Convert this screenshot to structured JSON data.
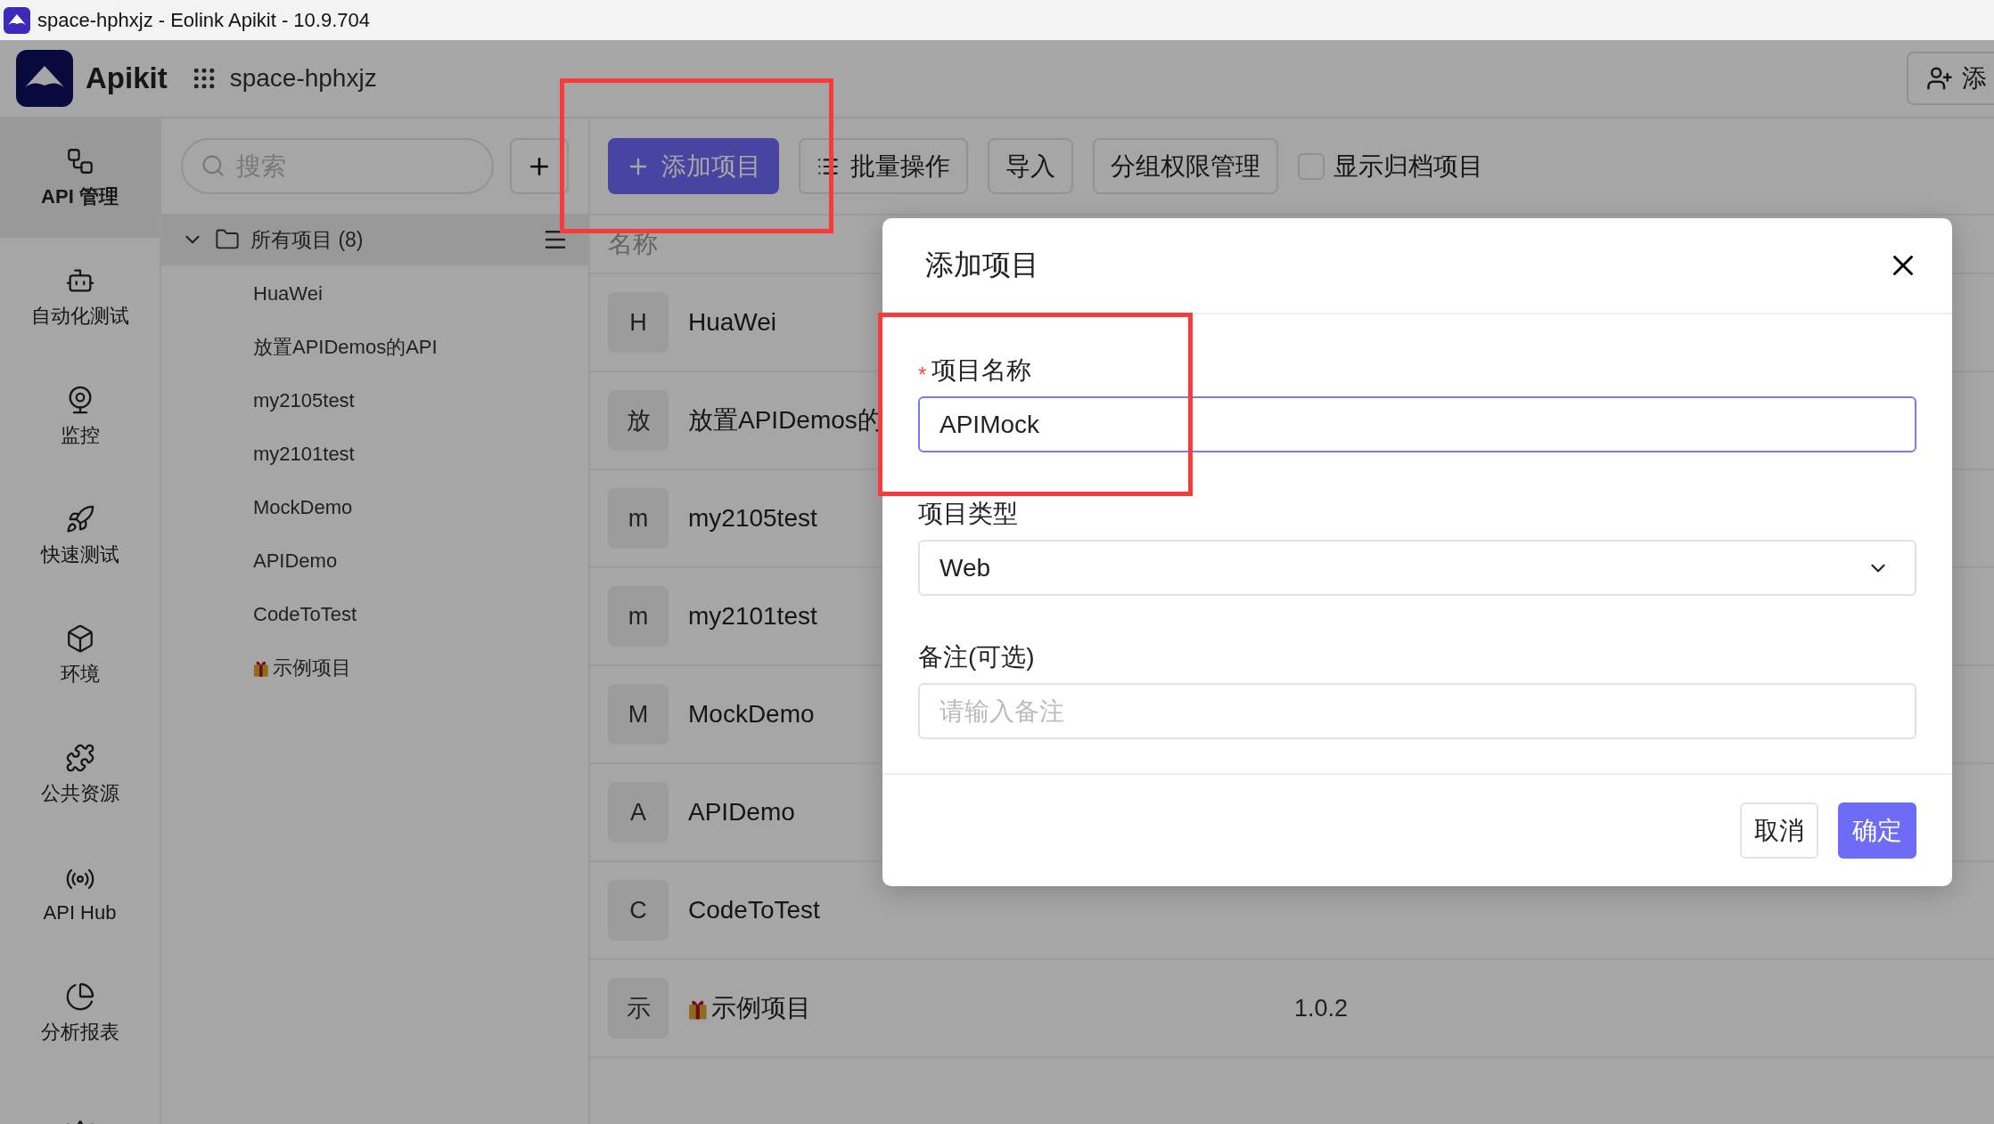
{
  "window": {
    "title": "space-hphxjz - Eolink Apikit - 10.9.704"
  },
  "header": {
    "brand": "Apikit",
    "workspace": "space-hphxjz",
    "action": "添"
  },
  "nav": [
    {
      "label": "API 管理",
      "selected": true
    },
    {
      "label": "自动化测试",
      "selected": false
    },
    {
      "label": "监控",
      "selected": false
    },
    {
      "label": "快速测试",
      "selected": false
    },
    {
      "label": "环境",
      "selected": false
    },
    {
      "label": "公共资源",
      "selected": false
    },
    {
      "label": "API Hub",
      "selected": false
    },
    {
      "label": "分析报表",
      "selected": false
    },
    {
      "selected": false
    }
  ],
  "search": {
    "placeholder": "搜索"
  },
  "tree": {
    "label": "所有项目",
    "count": "(8)",
    "expanded": true,
    "children": [
      {
        "label": "HuaWei",
        "featured": false
      },
      {
        "label": "放置APIDemos的API",
        "featured": false
      },
      {
        "label": "my2105test",
        "featured": false
      },
      {
        "label": "my2101test",
        "featured": false
      },
      {
        "label": "MockDemo",
        "featured": false
      },
      {
        "label": "APIDemo",
        "featured": false
      },
      {
        "label": "CodeToTest",
        "featured": false
      },
      {
        "label": "示例项目",
        "featured": true
      }
    ]
  },
  "toolbar": {
    "buttons": [
      {
        "label": "添加项目",
        "kind": "primary"
      },
      {
        "label": "批量操作",
        "kind": "list"
      },
      {
        "label": "导入",
        "kind": "plain"
      },
      {
        "label": "分组权限管理",
        "kind": "plain"
      }
    ],
    "archive": {
      "label": "显示归档项目",
      "checked": false
    }
  },
  "table": {
    "columns": [
      "名称"
    ],
    "rows": [
      {
        "initial": "H",
        "name": "HuaWei",
        "featured": false
      },
      {
        "initial": "放",
        "name": "放置APIDemos的",
        "featured": false
      },
      {
        "initial": "m",
        "name": "my2105test",
        "featured": false
      },
      {
        "initial": "m",
        "name": "my2101test",
        "featured": false
      },
      {
        "initial": "M",
        "name": "MockDemo",
        "featured": false
      },
      {
        "initial": "A",
        "name": "APIDemo",
        "featured": false
      },
      {
        "initial": "C",
        "name": "CodeToTest",
        "featured": false
      },
      {
        "initial": "示",
        "name": "示例项目",
        "featured": true,
        "version": "1.0.2"
      }
    ]
  },
  "dialog": {
    "title": "添加项目",
    "required_mark": "*",
    "fields": [
      {
        "kind": "input",
        "label": "项目名称",
        "required": true,
        "focused": true,
        "value": "APIMock"
      },
      {
        "kind": "select",
        "label": "项目类型",
        "required": false,
        "focused": false,
        "value": "Web"
      },
      {
        "kind": "input",
        "label": "备注(可选)",
        "required": false,
        "focused": false,
        "placeholder": "请输入备注"
      }
    ],
    "buttons": [
      {
        "label": "取消",
        "kind": "default"
      },
      {
        "label": "确定",
        "kind": "primary"
      }
    ]
  }
}
